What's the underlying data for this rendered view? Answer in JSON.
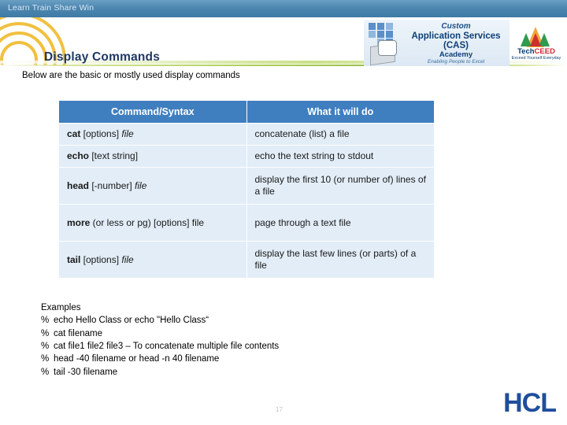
{
  "top_bar": {
    "text": "Learn   Train   Share   Win"
  },
  "header": {
    "title": "Display Commands",
    "cas_logo": {
      "line1": "Custom",
      "line2": "Application Services",
      "line3": "(CAS)",
      "line4": "Academy",
      "line5": "Enabling People to Excel"
    },
    "techceed": {
      "name_part1": "Tech",
      "name_part2": "CEED",
      "tagline": "Exceed Yourself Everyday"
    }
  },
  "intro": "Below are the basic or mostly used display commands",
  "table": {
    "headers": [
      "Command/Syntax",
      "What it will do"
    ],
    "rows": [
      {
        "syntax_bold": "cat",
        "syntax_plain": " [options] ",
        "syntax_italic": "file",
        "description": "concatenate (list) a file"
      },
      {
        "syntax_bold": "echo",
        "syntax_plain": " [text string]",
        "syntax_italic": "",
        "description": "echo the text string to stdout"
      },
      {
        "syntax_bold": "head",
        "syntax_plain": " [-number] ",
        "syntax_italic": "file",
        "description": "display the first 10 (or number of) lines of a file"
      },
      {
        "syntax_bold": "more",
        "syntax_plain": " (or less or pg) [options] file",
        "syntax_italic": "",
        "description": "page through a text file"
      },
      {
        "syntax_bold": "tail",
        "syntax_plain": " [options] ",
        "syntax_italic": "file",
        "description": "display the last few lines (or parts) of a file"
      }
    ]
  },
  "examples": {
    "heading": "Examples",
    "items": [
      "echo Hello Class or echo \"Hello Class“",
      "cat filename",
      "cat file1 file2 file3 – To concatenate multiple file contents",
      "head -40 filename or head -n 40 filename",
      "tail -30 filename"
    ],
    "prompt": "%"
  },
  "footer": {
    "page_number": "17",
    "brand": "HCL"
  },
  "colors": {
    "header_blue": "#3f7fbf",
    "cell_blue": "#e2edf7",
    "title_navy": "#1f3864",
    "band_green": "#9fc63a",
    "brand_blue": "#1f4e9c"
  }
}
